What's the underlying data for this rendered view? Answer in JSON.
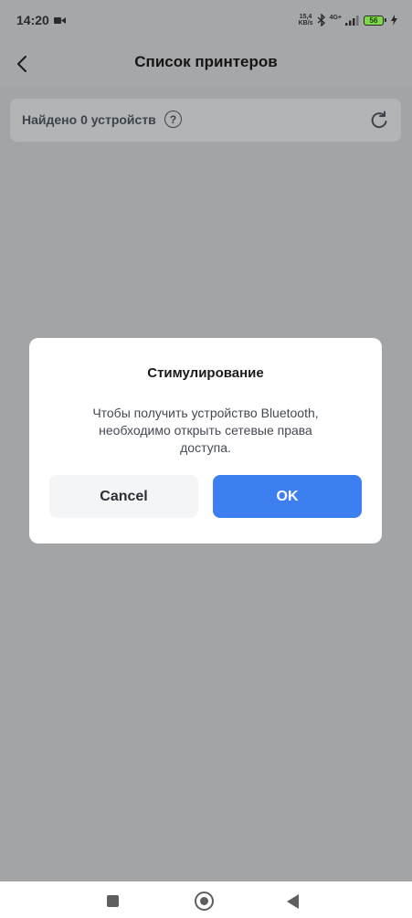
{
  "status_bar": {
    "time": "14:20",
    "net_speed_value": "15,4",
    "net_speed_unit": "KB/s",
    "network_type": "4G+",
    "battery": "56",
    "icons": [
      "video-camera-icon",
      "bluetooth-icon",
      "signal-icon",
      "battery-icon",
      "charging-icon"
    ]
  },
  "app_bar": {
    "title": "Список принтеров",
    "back_icon": "chevron-left-icon"
  },
  "scan": {
    "found_label": "Найдено 0 устройств",
    "help_symbol": "?",
    "refresh_icon": "refresh-icon"
  },
  "dialog": {
    "title": "Стимулирование",
    "message": "Чтобы получить устройство Bluetooth,\nнеобходимо открыть сетевые права\nдоступа.",
    "cancel_label": "Cancel",
    "ok_label": "OK"
  },
  "colors": {
    "accent": "#3d7ff0",
    "scrim": "#a5a7a9",
    "dialog_bg": "#ffffff",
    "battery_fill": "#7fd84a"
  },
  "nav_bar": {
    "icons": [
      "recent-apps-icon",
      "home-icon",
      "back-triangle-icon"
    ]
  }
}
